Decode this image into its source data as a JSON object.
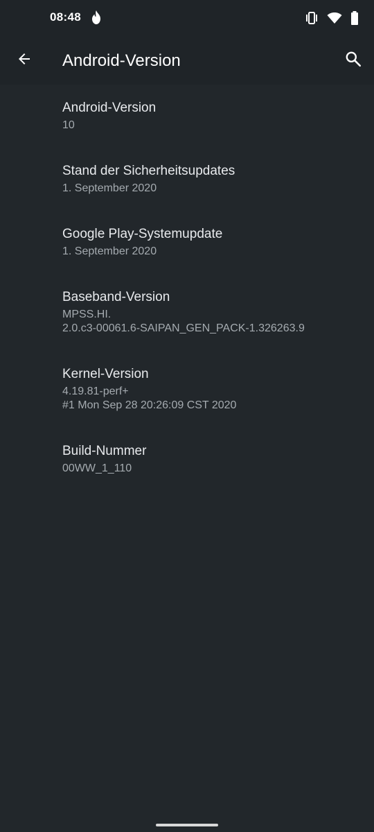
{
  "status_bar": {
    "time": "08:48",
    "icons": [
      "flame-icon",
      "vibrate-icon",
      "wifi-icon",
      "battery-icon"
    ]
  },
  "app_bar": {
    "title": "Android-Version",
    "back_icon": "arrow-back-icon",
    "search_icon": "search-icon"
  },
  "items": [
    {
      "title": "Android-Version",
      "summary": "10"
    },
    {
      "title": "Stand der Sicherheitsupdates",
      "summary": "1. September 2020"
    },
    {
      "title": "Google Play-Systemupdate",
      "summary": "1. September 2020"
    },
    {
      "title": "Baseband-Version",
      "summary": "MPSS.HI.\n2.0.c3-00061.6-SAIPAN_GEN_PACK-1.326263.9"
    },
    {
      "title": "Kernel-Version",
      "summary": "4.19.81-perf+\n#1 Mon Sep 28 20:26:09 CST 2020"
    },
    {
      "title": "Build-Nummer",
      "summary": "00WW_1_110"
    }
  ],
  "colors": {
    "background": "#22272b",
    "text_primary": "#e8eaed",
    "text_secondary": "#a5abb0"
  }
}
